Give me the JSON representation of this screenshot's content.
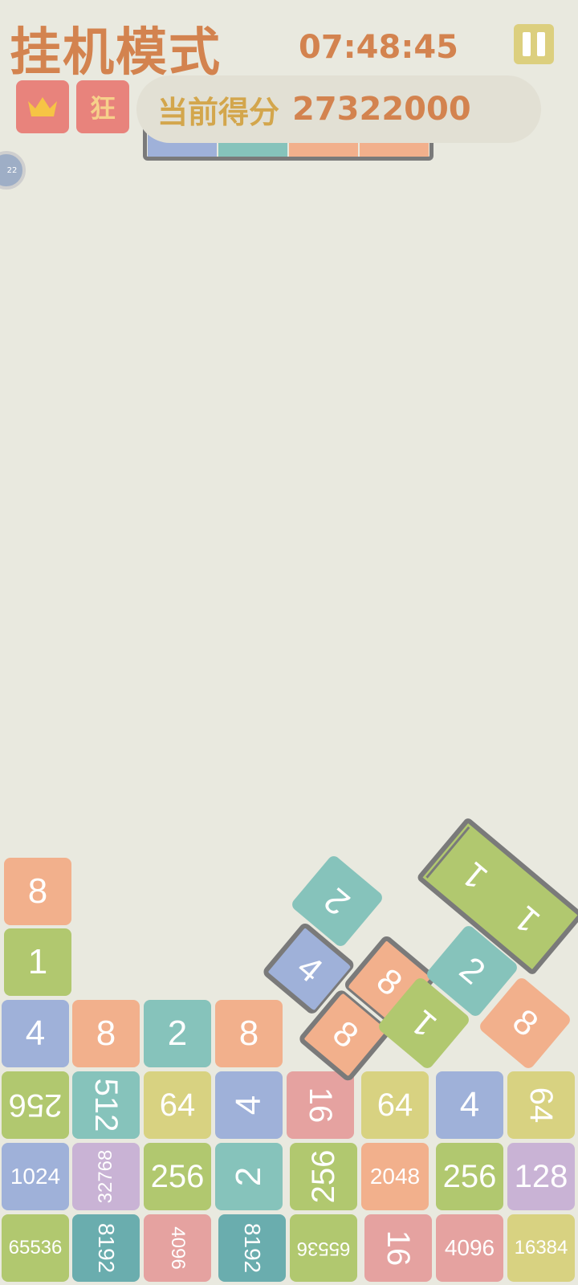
{
  "header": {
    "title": "挂机模式",
    "timer": "07:48:45",
    "pause_icon": "pause-icon"
  },
  "buttons": {
    "crown_icon": "crown-icon",
    "frenzy_label": "狂"
  },
  "score": {
    "label": "当前得分",
    "value": "27322000"
  },
  "side_bubble": {
    "label": "22"
  },
  "colors": {
    "background": "#e9e9df",
    "accent": "#d3834f",
    "orange": "#f2b08c",
    "green": "#b1c86f",
    "blue": "#9fb1d9",
    "teal": "#86c3bb",
    "yellow": "#d8d281",
    "pink": "#e5a2a0",
    "purple": "#c9b3d5"
  },
  "board": {
    "stack_col1": [
      "8",
      "1"
    ],
    "row4": [
      "4",
      "8",
      "2",
      "8"
    ],
    "row3": [
      "256",
      "512",
      "64",
      "4",
      "16",
      "64",
      "4",
      "64"
    ],
    "row2": [
      "1024",
      "32768",
      "256",
      "2",
      "256",
      "2048",
      "256",
      "128"
    ],
    "row1": [
      "65536",
      "8192",
      "4096",
      "8192",
      "65536",
      "16",
      "4096",
      "16384"
    ]
  },
  "falling": {
    "piece_a": [
      "4",
      "8",
      "8"
    ],
    "tile_a_top": "2",
    "piece_b": [
      "1",
      "1"
    ],
    "loose": [
      "2",
      "1",
      "8"
    ]
  }
}
